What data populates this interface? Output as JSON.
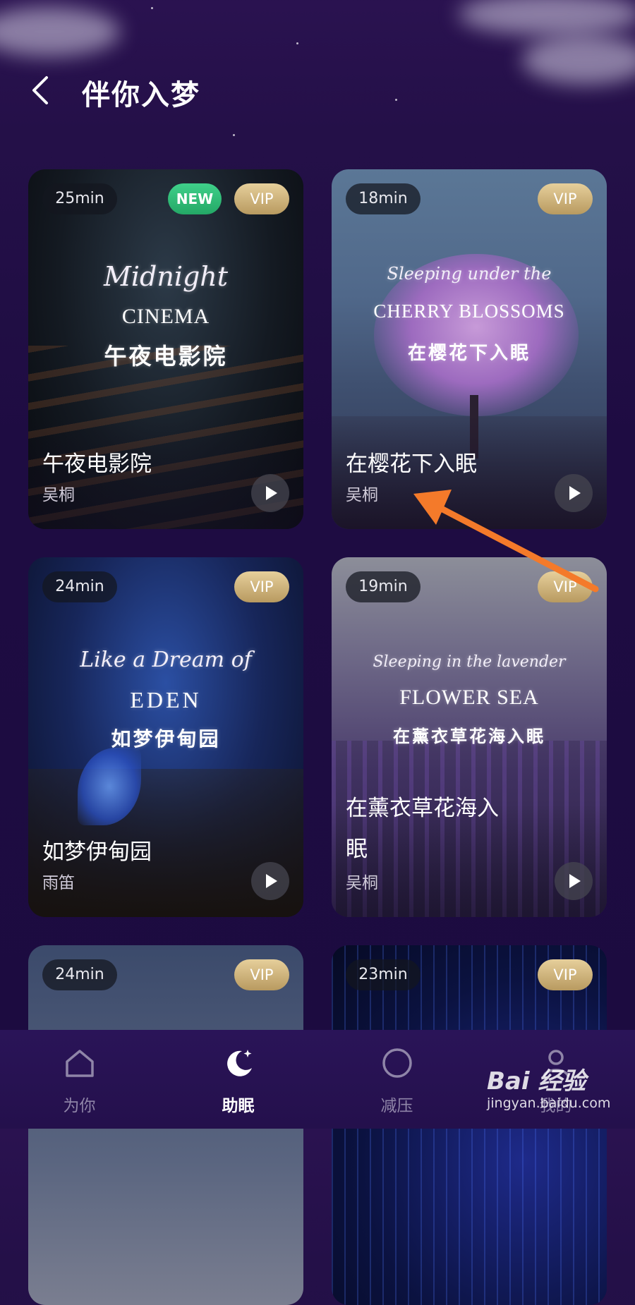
{
  "header": {
    "title": "伴你入梦"
  },
  "cards": [
    {
      "duration": "25min",
      "badge_new": "NEW",
      "badge_vip": "VIP",
      "art_script": "Midnight",
      "art_caps": "CINEMA",
      "art_cn": "午夜电影院",
      "name": "午夜电影院",
      "author": "吴桐"
    },
    {
      "duration": "18min",
      "badge_vip": "VIP",
      "art_script": "Sleeping under the",
      "art_caps": "CHERRY BLOSSOMS",
      "art_cn": "在樱花下入眠",
      "name": "在樱花下入眠",
      "author": "吴桐"
    },
    {
      "duration": "24min",
      "badge_vip": "VIP",
      "art_script": "Like a Dream of",
      "art_caps": "EDEN",
      "art_cn": "如梦伊甸园",
      "name": "如梦伊甸园",
      "author": "雨笛"
    },
    {
      "duration": "19min",
      "badge_vip": "VIP",
      "art_script": "Sleeping in the lavender",
      "art_caps": "FLOWER SEA",
      "art_cn": "在薰衣草花海入眠",
      "name_line1": "在薰衣草花海入",
      "name_line2": "眠",
      "author": "吴桐"
    },
    {
      "duration": "24min",
      "badge_vip": "VIP"
    },
    {
      "duration": "23min",
      "badge_vip": "VIP"
    }
  ],
  "tabbar": {
    "tabs": [
      {
        "label": "为你",
        "icon": "home-icon"
      },
      {
        "label": "助眠",
        "icon": "moon-star-icon",
        "active": true
      },
      {
        "label": "减压",
        "icon": "circle-icon"
      },
      {
        "label": "我的",
        "icon": "profile-icon"
      }
    ]
  },
  "watermark": {
    "brand": "Bai 经验",
    "url": "jingyan.baidu.com"
  },
  "colors": {
    "accent_new": "#2fbd78",
    "vip_gold": "#d2b87e",
    "annotation_arrow": "#f47a2a"
  }
}
